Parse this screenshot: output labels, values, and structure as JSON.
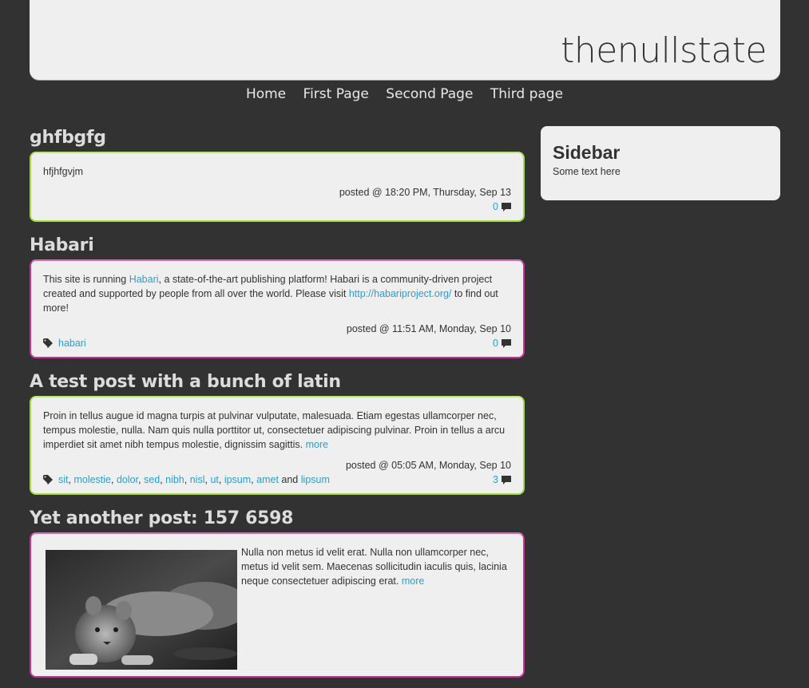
{
  "site": {
    "title": "thenullstate"
  },
  "nav": [
    "Home",
    "First Page",
    "Second Page",
    "Third page"
  ],
  "sidebar": {
    "title": "Sidebar",
    "text": "Some text here"
  },
  "posts": [
    {
      "title": "ghfbgfg",
      "body": "hfjhfgvjm",
      "posted": "posted @ 18:20 PM, Thursday, Sep 13",
      "comments": "0"
    },
    {
      "title": "Habari",
      "body_parts": [
        "This site is running ",
        "Habari",
        ", a state-of-the-art publishing platform! Habari is a community-driven project created and supported by people from all over the world. Please visit ",
        "http://habariproject.org/",
        " to find out more!"
      ],
      "posted": "posted @ 11:51 AM, Monday, Sep 10",
      "tags": [
        "habari"
      ],
      "comments": "0"
    },
    {
      "title": "A test post with a bunch of latin",
      "body": "Proin in tellus augue id magna turpis at pulvinar vulputate, malesuada. Etiam egestas ullamcorper nec, tempus molestie, nulla. Nam quis nulla porttitor ut, consectetuer adipiscing pulvinar. Proin in tellus a arcu imperdiet sit amet nibh tempus molestie, dignissim sagittis. ",
      "more": "more",
      "posted": "posted @ 05:05 AM, Monday, Sep 10",
      "tags": [
        "sit",
        "molestie",
        "dolor",
        "sed",
        "nibh",
        "nisl",
        "ut",
        "ipsum",
        "amet",
        "lipsum"
      ],
      "tags_and": "and",
      "comments": "3"
    },
    {
      "title": "Yet another post: 157 6598",
      "body": "Nulla non metus id velit erat. Nulla non ullamcorper nec, metus id velit sem. Maecenas sollicitudin iaculis quis, lacinia neque consectetuer adipiscing erat. ",
      "more": "more"
    }
  ],
  "icons": {
    "tag": "tag-icon",
    "comment": "comment-icon"
  },
  "colors": {
    "background": "#323232",
    "panel": "#efefef",
    "link": "#2a9fd6",
    "green_border": "#a2dd3a",
    "magenta_border": "#c9329b"
  }
}
